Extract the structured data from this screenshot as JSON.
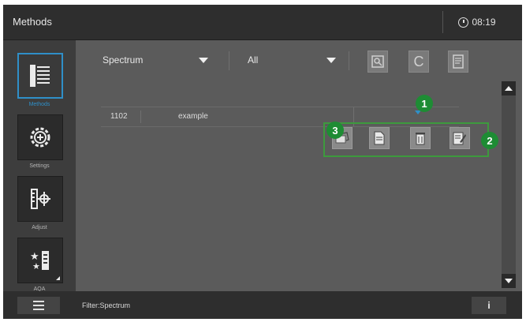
{
  "header": {
    "title": "Methods",
    "time": "08:19"
  },
  "sidebar": {
    "items": [
      {
        "label": "Methods",
        "icon": "list-icon",
        "active": true
      },
      {
        "label": "Settings",
        "icon": "gear-icon",
        "active": false
      },
      {
        "label": "Adjust",
        "icon": "adjust-icon",
        "active": false
      },
      {
        "label": "AQA",
        "icon": "aqa-icon",
        "active": false
      }
    ]
  },
  "toolbar": {
    "type_select": "Spectrum",
    "filter_select": "All",
    "buttons": [
      "search-icon",
      "clear-icon",
      "document-icon"
    ],
    "clear_label": "C"
  },
  "table": {
    "rows": [
      {
        "id": "1102",
        "name": "example"
      }
    ]
  },
  "callouts": [
    "1",
    "2",
    "3"
  ],
  "footer": {
    "filter_text": "Filter:Spectrum",
    "info_label": "i"
  },
  "colors": {
    "accent": "#2f8fc8",
    "callout": "#1e8c34",
    "callout_border": "#3d9a3d"
  }
}
